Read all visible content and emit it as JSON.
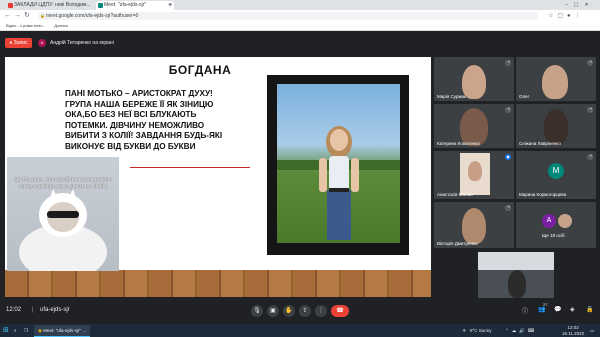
{
  "browser": {
    "tabs": [
      {
        "title": "ЗАКЛАДИ ЦДПУ: нові Володим...",
        "fav_color": "#e53935"
      },
      {
        "title": "Meet: \"ufa-ejds-sjr\"",
        "fav_color": "#00897b"
      }
    ],
    "new_tab": "+",
    "url": "meet.google.com/ufa-ejds-sjr?authuser=0",
    "bookmarks": [
      "Відео - з усіма плат...",
      "Дописи"
    ]
  },
  "meet": {
    "recording_label": "Запис",
    "presenter_initial": "А",
    "presenter_label": "Андрій Титаренко на екрані",
    "clock": "12:02",
    "meeting_code": "ufa-ejds-sjr",
    "participant_count": "27",
    "participants": [
      {
        "name": "Марія Суржик",
        "color": "#7a5a4a"
      },
      {
        "name": "Олег",
        "color": "#2e3b4e"
      },
      {
        "name": "Катерина Коваленко",
        "color": "#6b4e3d"
      },
      {
        "name": "Сніжана Лавріненко",
        "color": "#4a3b35"
      },
      {
        "name": "Анастасія Малий",
        "color": "#c89f86"
      },
      {
        "name": "Марина Кормогорцева",
        "color": "#3c4043"
      },
      {
        "name": "Вікторія Дмитренко",
        "color": "#5e4a40"
      },
      {
        "name": "Ще 18 осіб",
        "color": "#3c4043"
      }
    ],
    "more_avatar_initial": "А",
    "more_avatar_color": "#7b1fa2",
    "marina_avatar_initial": "М"
  },
  "slide": {
    "title": "БОГДАНА",
    "quote_lines": [
      "ПАНІ МОТЬКО – АРИСТОКРАТ ДУХУ!",
      "ГРУПА НАША БЕРЕЖЕ ЇЇ ЯК ЗІНИЦЮ",
      "ОКА,БО БЕЗ НЕЇ ВСІ БЛУКАЮТЬ",
      "ПОТЕМКИ. ДІВЧИНУ НЕМОЖЛИВО",
      "ВИБИТИ З КОЛІЇ! ЗАВДАННЯ БУДЬ-ЯКІ",
      "ВИКОНУЄ ВІД БУКВИ ДО БУКВИ"
    ],
    "meme_text": "Це Богдана, коли зробила всі завдання і тепер спокійно може дивитись Netflix"
  },
  "taskbar": {
    "search_placeholder": "",
    "active_window": "Meet: \"ufa-ejds-sjr\" ...",
    "weather": "8°C  Sunny",
    "time": "12:02",
    "date": "16.11.2022"
  }
}
